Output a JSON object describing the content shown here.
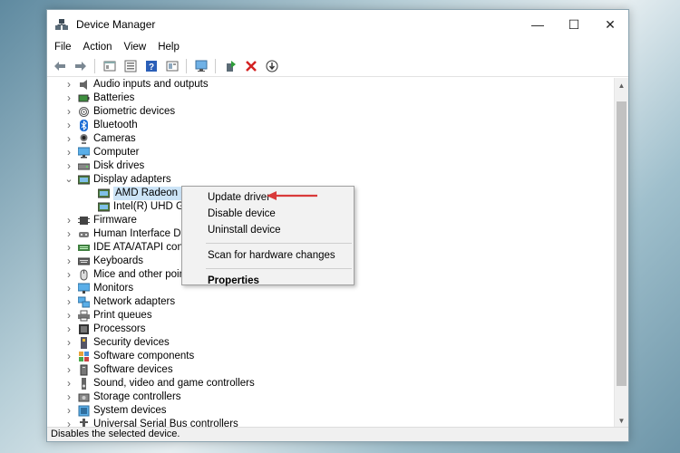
{
  "window": {
    "title": "Device Manager"
  },
  "controls": {
    "minimize": "—",
    "maximize": "☐",
    "close": "✕"
  },
  "menubar": [
    "File",
    "Action",
    "View",
    "Help"
  ],
  "toolbar": [
    {
      "icon": "back-arrow-icon"
    },
    {
      "icon": "forward-arrow-icon"
    },
    {
      "icon": "properties-icon"
    },
    {
      "icon": "device-list-icon"
    },
    {
      "icon": "help-icon"
    },
    {
      "icon": "view-icon"
    },
    {
      "icon": "monitor-scan-icon"
    },
    {
      "icon": "update-driver-icon"
    },
    {
      "icon": "uninstall-x-icon"
    },
    {
      "icon": "download-circle-icon"
    }
  ],
  "tree": [
    {
      "label": "Audio inputs and outputs",
      "icon": "speaker-icon",
      "chev": ">"
    },
    {
      "label": "Batteries",
      "icon": "battery-icon",
      "chev": ">"
    },
    {
      "label": "Biometric devices",
      "icon": "fingerprint-icon",
      "chev": ">"
    },
    {
      "label": "Bluetooth",
      "icon": "bluetooth-icon",
      "chev": ">"
    },
    {
      "label": "Cameras",
      "icon": "camera-icon",
      "chev": ">"
    },
    {
      "label": "Computer",
      "icon": "computer-icon",
      "chev": ">"
    },
    {
      "label": "Disk drives",
      "icon": "disk-drive-icon",
      "chev": ">"
    },
    {
      "label": "Display adapters",
      "icon": "display-adapter-icon",
      "chev": "v"
    },
    {
      "label": "AMD Radeon (TM)",
      "icon": "display-adapter-icon",
      "child": true,
      "selected": true
    },
    {
      "label": "Intel(R) UHD Graph",
      "icon": "display-adapter-icon",
      "child": true
    },
    {
      "label": "Firmware",
      "icon": "firmware-icon",
      "chev": ">"
    },
    {
      "label": "Human Interface Devic",
      "icon": "hid-icon",
      "chev": ">"
    },
    {
      "label": "IDE ATA/ATAPI controlle",
      "icon": "ide-icon",
      "chev": ">"
    },
    {
      "label": "Keyboards",
      "icon": "keyboard-icon",
      "chev": ">"
    },
    {
      "label": "Mice and other pointin",
      "icon": "mouse-icon",
      "chev": ">"
    },
    {
      "label": "Monitors",
      "icon": "monitor-icon",
      "chev": ">"
    },
    {
      "label": "Network adapters",
      "icon": "network-icon",
      "chev": ">"
    },
    {
      "label": "Print queues",
      "icon": "printer-icon",
      "chev": ">"
    },
    {
      "label": "Processors",
      "icon": "processor-icon",
      "chev": ">"
    },
    {
      "label": "Security devices",
      "icon": "security-icon",
      "chev": ">"
    },
    {
      "label": "Software components",
      "icon": "software-component-icon",
      "chev": ">"
    },
    {
      "label": "Software devices",
      "icon": "software-device-icon",
      "chev": ">"
    },
    {
      "label": "Sound, video and game controllers",
      "icon": "sound-icon",
      "chev": ">"
    },
    {
      "label": "Storage controllers",
      "icon": "storage-icon",
      "chev": ">"
    },
    {
      "label": "System devices",
      "icon": "system-icon",
      "chev": ">"
    },
    {
      "label": "Universal Serial Bus controllers",
      "icon": "usb-icon",
      "chev": ">"
    }
  ],
  "context_menu": {
    "update": "Update driver",
    "disable": "Disable device",
    "uninstall": "Uninstall device",
    "scan": "Scan for hardware changes",
    "properties": "Properties"
  },
  "scroll": {
    "up": "▲",
    "down": "▼"
  },
  "status": {
    "text": "Disables the selected device."
  },
  "colors": {
    "selection": "#cce4f7",
    "annotation_arrow": "#d93a3a",
    "accent_blue": "#1e5fb4"
  }
}
